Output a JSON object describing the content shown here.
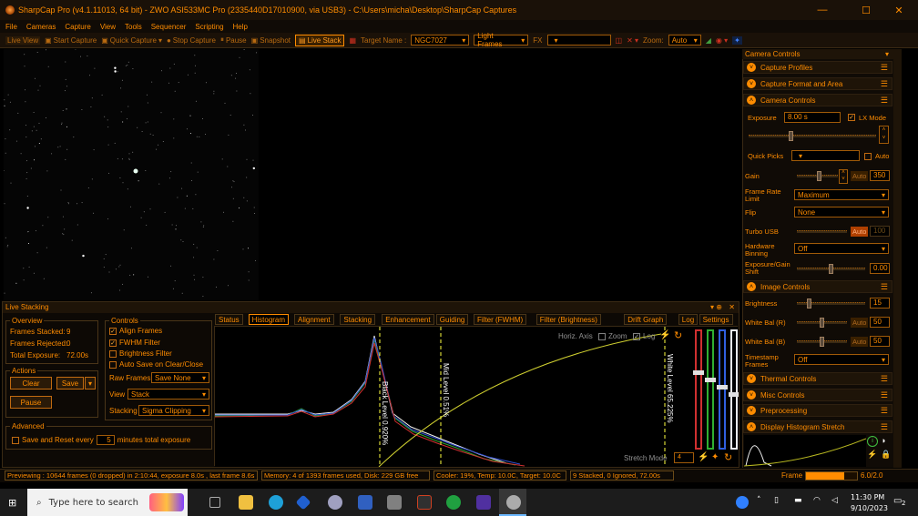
{
  "window": {
    "title": "SharpCap Pro (v4.1.11013, 64 bit) - ZWO ASI533MC Pro (2335440D17010900, via USB3) - C:\\Users\\micha\\Desktop\\SharpCap Captures"
  },
  "menu": [
    "File",
    "Cameras",
    "Capture",
    "View",
    "Tools",
    "Sequencer",
    "Scripting",
    "Help"
  ],
  "toolbar": {
    "live_view": "Live View",
    "start_capture": "Start Capture",
    "quick_capture": "Quick Capture",
    "stop_capture": "Stop Capture",
    "pause": "Pause",
    "snapshot": "Snapshot",
    "live_stack": "Live Stack",
    "target_label": "Target Name :",
    "target_value": "NGC7027",
    "frame_type": "Light Frames",
    "fx": "FX",
    "zoom_label": "Zoom:",
    "zoom_value": "Auto"
  },
  "live_stacking": {
    "title": "Live Stacking",
    "overview": {
      "title": "Overview",
      "frames_stacked_label": "Frames Stacked:",
      "frames_stacked": "9",
      "frames_rejected_label": "Frames Rejected:",
      "frames_rejected": "0",
      "total_exposure_label": "Total Exposure:",
      "total_exposure": "72.00s"
    },
    "actions": {
      "title": "Actions",
      "clear": "Clear",
      "save": "Save",
      "pause": "Pause"
    },
    "controls": {
      "title": "Controls",
      "align_frames": "Align Frames",
      "fwhm_filter": "FWHM Filter",
      "brightness_filter": "Brightness Filter",
      "auto_save": "Auto Save on Clear/Close",
      "raw_frames_label": "Raw Frames",
      "raw_frames_value": "Save None",
      "view_label": "View",
      "view_value": "Stack",
      "stacking_label": "Stacking",
      "stacking_value": "Sigma Clipping"
    },
    "advanced": {
      "title": "Advanced",
      "save_reset_label": "Save and Reset every",
      "save_reset_value": "5",
      "minutes_label": "minutes total exposure"
    },
    "tabs": [
      "Status",
      "Histogram",
      "Alignment",
      "Stacking",
      "Enhancement",
      "Guiding",
      "Filter (FWHM)",
      "Filter (Brightness)",
      "Drift Graph",
      "Log",
      "Settings"
    ],
    "active_tab": "Histogram",
    "histogram": {
      "horiz_axis": "Horiz. Axis",
      "zoom": "Zoom",
      "log": "Log",
      "black_level": "Black Level 0.920%",
      "mid_level": "Mid Level 0.51%",
      "white_level": "White Level 65.225%",
      "stretch_mode": "Stretch Mode",
      "stretch_value": "4"
    }
  },
  "status": {
    "previewing": "Previewing : 10644 frames (0 dropped) in 2:10:44, exposure 8.0s , last frame 8.6s",
    "memory": "Memory: 4 of 1393 frames used, Disk: 229 GB free",
    "cooler": "Cooler: 19%, Temp: 10.0C, Target: 10.0C",
    "stacked": "9 Stacked, 0 Ignored, 72.00s",
    "frame_label": "Frame :",
    "frame_value": "6.0/2.0",
    "frame_progress": 0.75
  },
  "camera_controls": {
    "title": "Camera Controls",
    "sections": {
      "capture_profiles": "Capture Profiles",
      "capture_format": "Capture Format and Area",
      "camera_controls": "Camera Controls",
      "image_controls": "Image Controls",
      "thermal_controls": "Thermal Controls",
      "misc_controls": "Misc Controls",
      "preprocessing": "Preprocessing",
      "display_histogram": "Display Histogram Stretch"
    },
    "exposure_label": "Exposure",
    "exposure_value": "8.00 s",
    "lx_mode": "LX Mode",
    "quick_picks_label": "Quick Picks",
    "quick_auto": "Auto",
    "gain_label": "Gain",
    "gain_auto": "Auto",
    "gain_value": "350",
    "gain_level": 0.55,
    "frame_rate_label": "Frame Rate Limit",
    "frame_rate_value": "Maximum",
    "flip_label": "Flip",
    "flip_value": "None",
    "turbo_label": "Turbo USB",
    "turbo_auto": "Auto",
    "turbo_value": "100",
    "binning_label": "Hardware Binning",
    "binning_value": "Off",
    "exp_gain_label": "Exposure/Gain Shift",
    "exp_gain_value": "0.00",
    "brightness_label": "Brightness",
    "brightness_value": "15",
    "brightness_level": 0.15,
    "wb_r_label": "White Bal (R)",
    "wb_r_auto": "Auto",
    "wb_r_value": "50",
    "wb_r_level": 0.5,
    "wb_b_label": "White Bal (B)",
    "wb_b_auto": "Auto",
    "wb_b_value": "50",
    "wb_b_level": 0.5,
    "timestamp_label": "Timestamp Frames",
    "timestamp_value": "Off"
  },
  "taskbar": {
    "search_placeholder": "Type here to search",
    "time": "11:30 PM",
    "date": "9/10/2023",
    "notif_count": "2"
  }
}
